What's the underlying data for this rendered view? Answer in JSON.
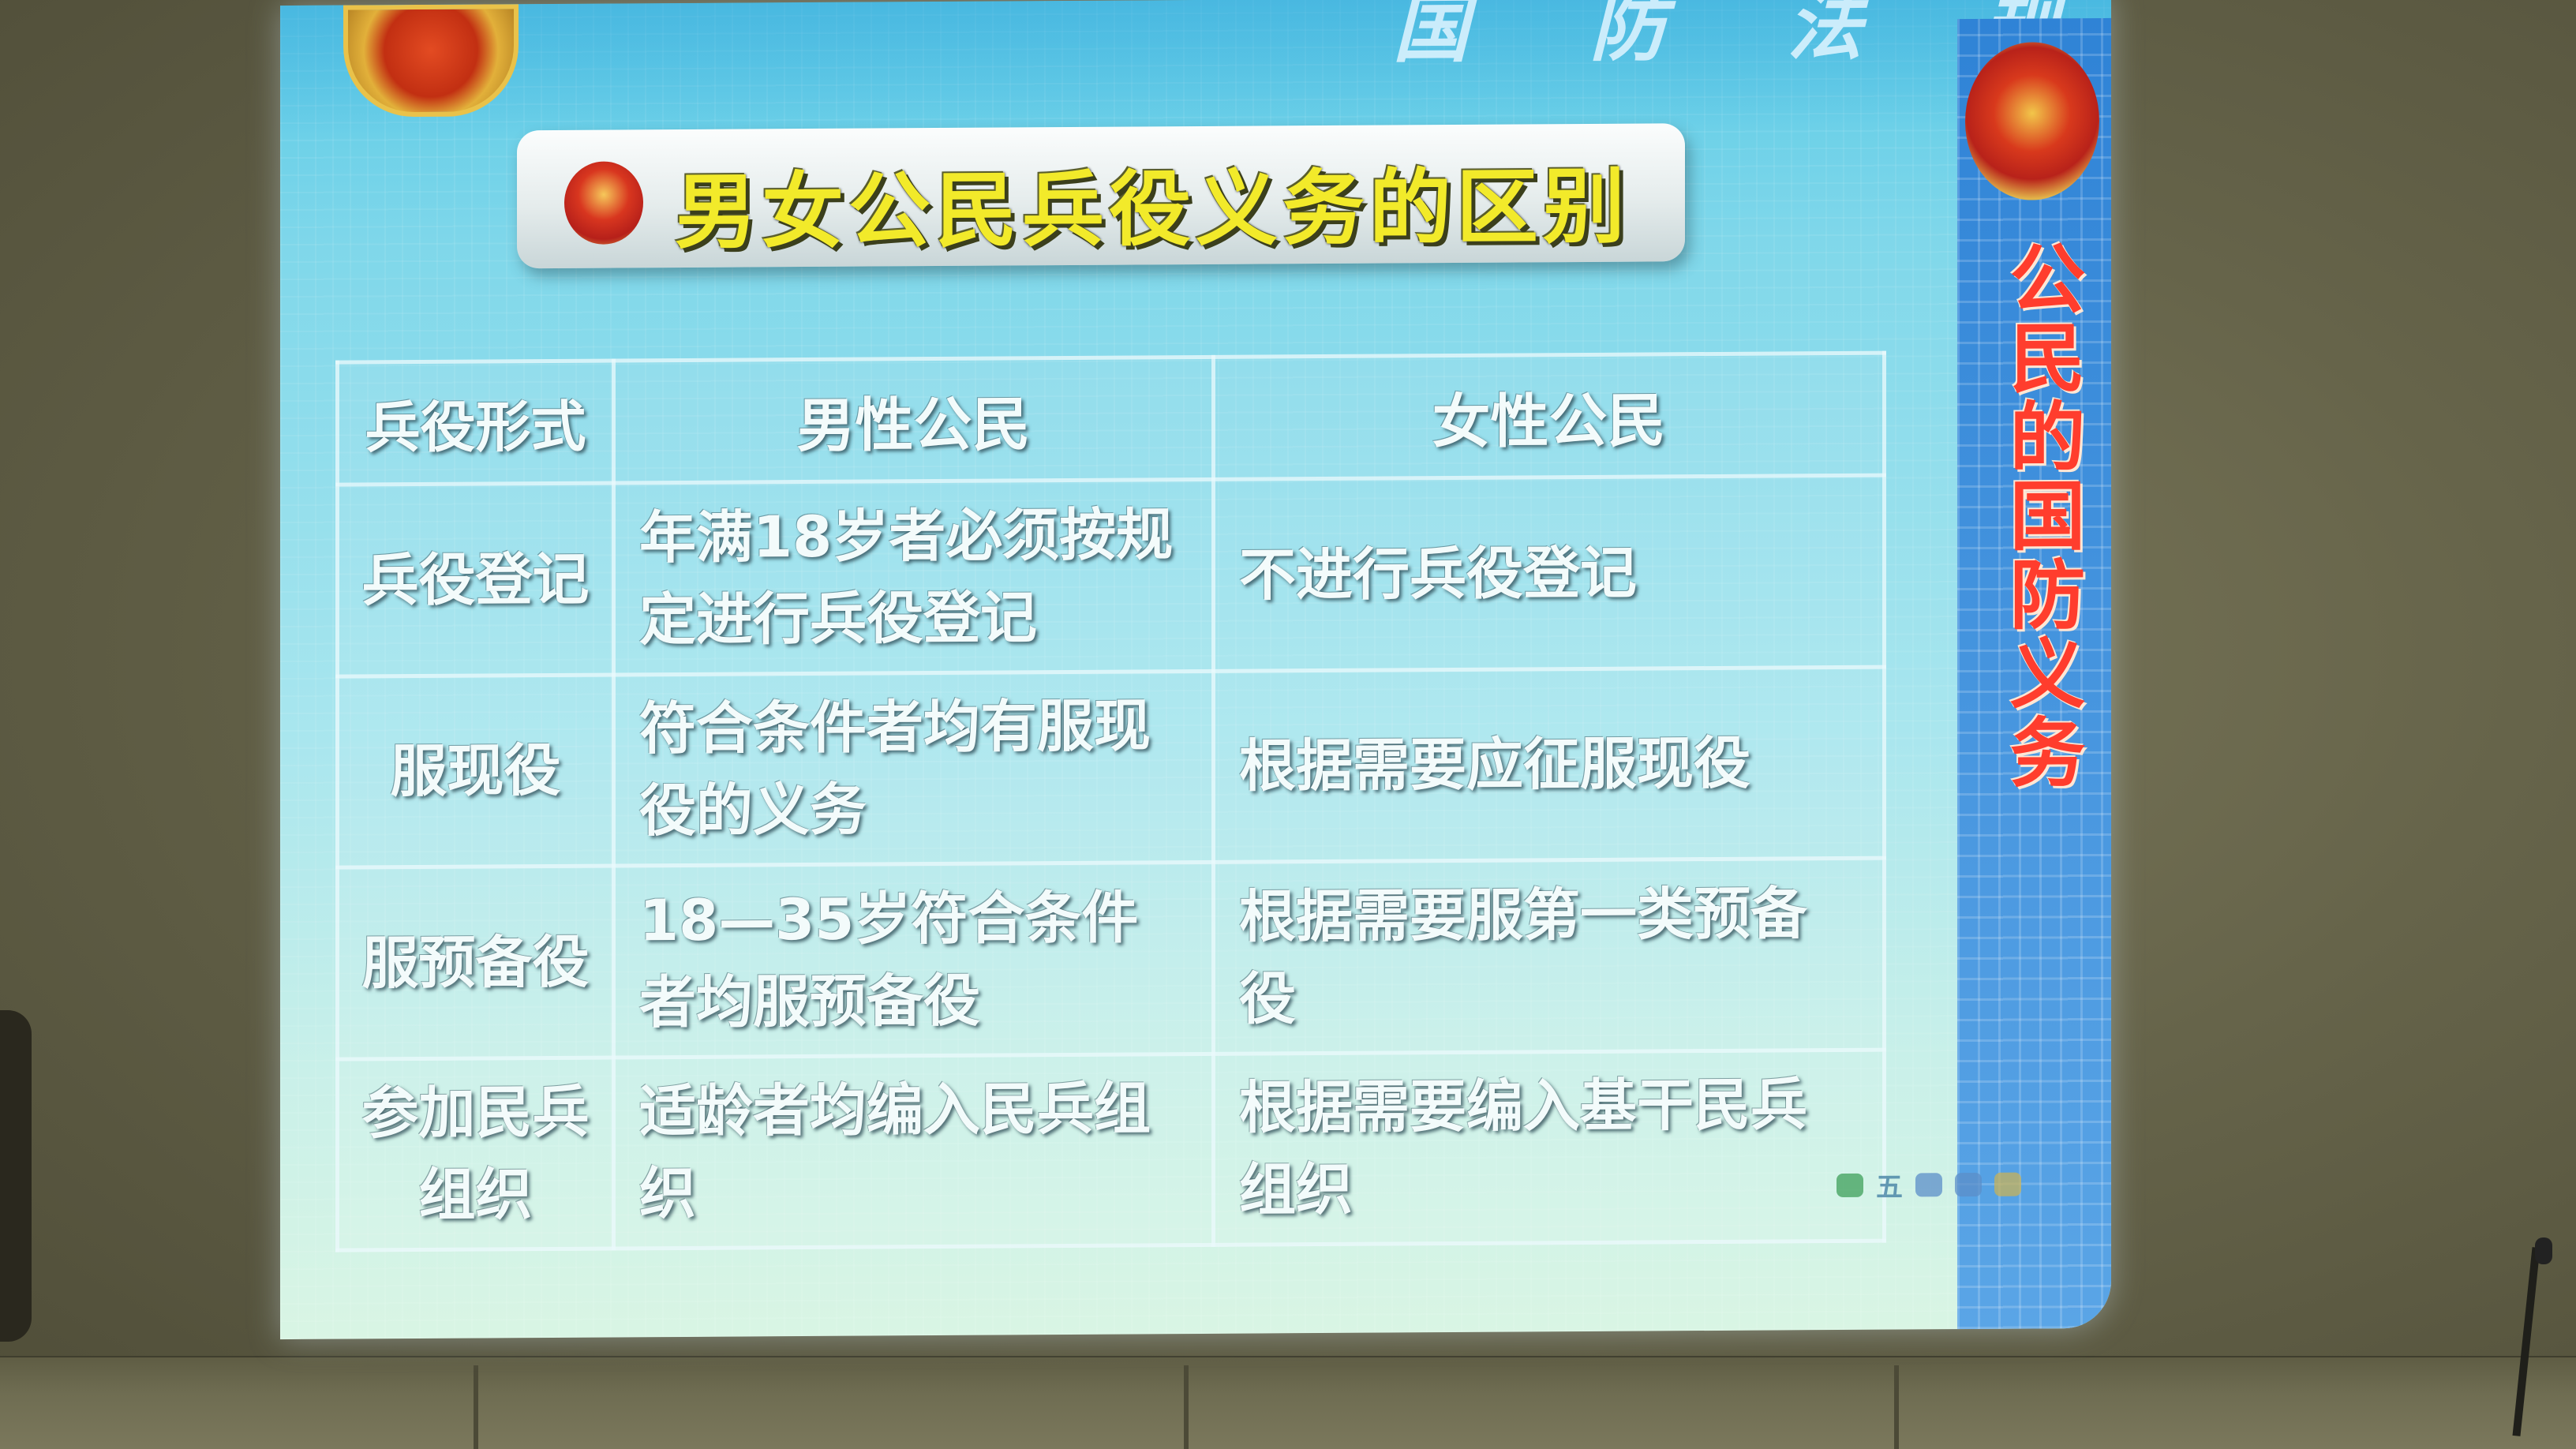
{
  "slide": {
    "header": "国 防 法 规",
    "title": "男女公民兵役义务的区别",
    "side_title": "公民的国防义务"
  },
  "table": {
    "headers": [
      "兵役形式",
      "男性公民",
      "女性公民"
    ],
    "rows": [
      {
        "form": "兵役登记",
        "male": "年满18岁者必须按规定进行兵役登记",
        "female": "不进行兵役登记"
      },
      {
        "form": "服现役",
        "male": "符合条件者均有服现役的义务",
        "female": "根据需要应征服现役"
      },
      {
        "form": "服预备役",
        "male": "18—35岁符合条件者均服预备役",
        "female": "根据需要服第一类预备役"
      },
      {
        "form": "参加民兵组织",
        "male": "适龄者均编入民兵组织",
        "female": "根据需要编入基干民兵组织"
      }
    ]
  },
  "taskbar": {
    "label": "五"
  },
  "colors": {
    "title_text": "#f2ea2a",
    "side_title": "#ff3d2d",
    "slide_bg": "#a9e6ee",
    "side_panel": "#4a98e0"
  }
}
